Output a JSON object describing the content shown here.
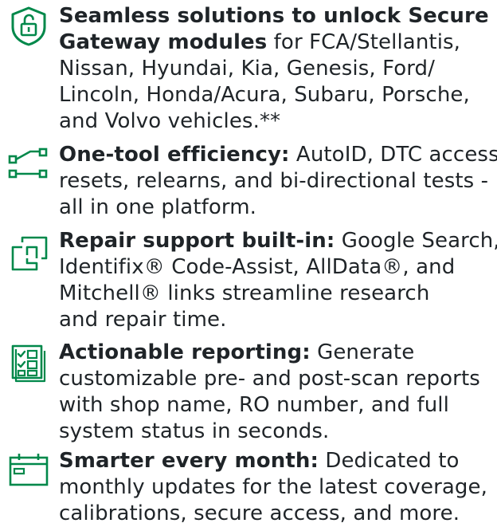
{
  "accent_color": "#00884a",
  "features": [
    {
      "icon": "unlock-shield-icon",
      "title": "Seamless solutions to unlock Secure Gateway modules",
      "body": "for FCA/Stellantis, Nissan, Hyundai, Kia, Genesis, Ford/ Lincoln, Honda/Acura, Subaru, Porsche, and Volvo vehicles.**",
      "lines": [
        {
          "bold": "Seamless solutions to unlock Secure",
          "normal": ""
        },
        {
          "bold": "Gateway modules",
          "normal": " for FCA/Stellantis,"
        },
        {
          "bold": "",
          "normal": "Nissan, Hyundai, Kia, Genesis, Ford/"
        },
        {
          "bold": "",
          "normal": "Lincoln, Honda/Acura, Subaru, Porsche,"
        },
        {
          "bold": "",
          "normal": "and Volvo vehicles.**"
        }
      ]
    },
    {
      "icon": "connection-icon",
      "title": "One-tool efficiency:",
      "body": "AutoID, DTC access, resets, relearns, and bi-directional tests - all in one platform.",
      "lines": [
        {
          "bold": "One-tool efficiency:",
          "normal": " AutoID, DTC access,"
        },
        {
          "bold": "",
          "normal": "resets, relearns, and bi-directional tests -"
        },
        {
          "bold": "",
          "normal": "all in one platform."
        }
      ]
    },
    {
      "icon": "copy-link-icon",
      "title": "Repair support built-in:",
      "body": "Google Search, Identifix® Code-Assist, AllData®, and Mitchell® links streamline research and repair time.",
      "lines": [
        {
          "bold": "Repair support built-in:",
          "normal": " Google Search,"
        },
        {
          "bold": "",
          "normal": "Identifix® Code-Assist, AllData®, and"
        },
        {
          "bold": "",
          "normal": "Mitchell® links streamline research"
        },
        {
          "bold": "",
          "normal": "and repair time."
        }
      ]
    },
    {
      "icon": "checklist-report-icon",
      "title": "Actionable reporting:",
      "body": "Generate customizable pre- and post-scan reports with shop name, RO number, and full system status in seconds.",
      "lines": [
        {
          "bold": "Actionable reporting:",
          "normal": " Generate"
        },
        {
          "bold": "",
          "normal": "customizable pre- and post-scan reports"
        },
        {
          "bold": "",
          "normal": "with shop name, RO number, and full"
        },
        {
          "bold": "",
          "normal": "system status in seconds."
        }
      ]
    },
    {
      "icon": "calendar-icon",
      "title": "Smarter every month:",
      "body": "Dedicated to monthly updates for the latest coverage, calibrations, secure access, and more.",
      "lines": [
        {
          "bold": "Smarter every month:",
          "normal": " Dedicated to"
        },
        {
          "bold": "",
          "normal": "monthly updates for the latest coverage,"
        },
        {
          "bold": "",
          "normal": "calibrations, secure access, and more."
        }
      ]
    }
  ]
}
